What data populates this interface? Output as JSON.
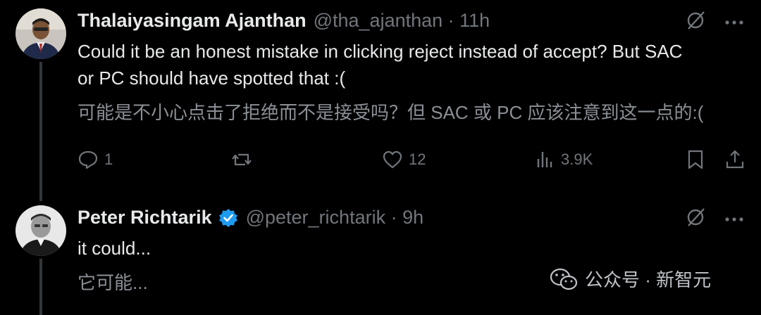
{
  "tweets": [
    {
      "author_name": "Thalaiyasingam Ajanthan",
      "handle_time": "@tha_ajanthan · 11h",
      "text": "Could it be an honest mistake in clicking reject instead of accept? But SAC\nor PC should have spotted that :(",
      "translation": "可能是不小心点击了拒绝而不是接受吗？但 SAC 或 PC 应该注意到这一点的:(",
      "actions": {
        "replies": "1",
        "reposts": "",
        "likes": "12",
        "views": "3.9K"
      }
    },
    {
      "author_name": "Peter Richtarik",
      "verified": true,
      "handle_time": "@peter_richtarik · 9h",
      "text": "it could...",
      "translation": "它可能..."
    }
  ],
  "watermark": {
    "text": "公众号 · 新智元",
    "icon": "wechat-icon"
  },
  "colors": {
    "background": "#000000",
    "text": "#e7e9ea",
    "muted": "#71767b",
    "verified": "#1d9bf0"
  }
}
